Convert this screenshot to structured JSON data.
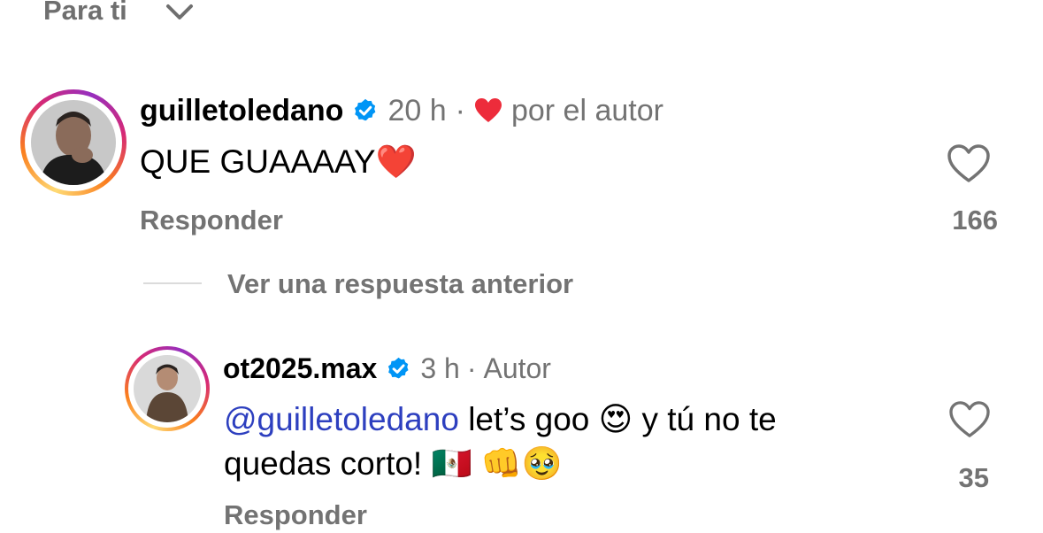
{
  "header": {
    "filter_label": "Para ti",
    "chevron_icon": "chevron-down-icon"
  },
  "comments": [
    {
      "username": "guilletoledano",
      "verified": true,
      "time": "20 h",
      "separator": "·",
      "liked_by_author_icon": "red-heart-icon",
      "liked_by_author_text": "por el autor",
      "text": "QUE GUAAAAY",
      "text_emoji": "❤️",
      "reply_label": "Responder",
      "like_count": "166"
    }
  ],
  "view_replies_label": "Ver una respuesta anterior",
  "reply": {
    "username": "ot2025.max",
    "verified": true,
    "time": "3 h",
    "separator": "·",
    "author_badge": "Autor",
    "mention": "@guilletoledano",
    "text_part1": " let’s goo ",
    "emoji1": "😍",
    "text_part2": " y tú no te",
    "text_line2": "quedas corto! ",
    "emoji2": "🇲🇽",
    "emoji3": "👊",
    "emoji4": "🥹",
    "reply_label": "Responder",
    "like_count": "35"
  },
  "colors": {
    "accent_blue": "#0095f6",
    "mention_blue": "#2d3fbf",
    "muted_gray": "#737373",
    "heart_red": "#ed2c3b"
  }
}
